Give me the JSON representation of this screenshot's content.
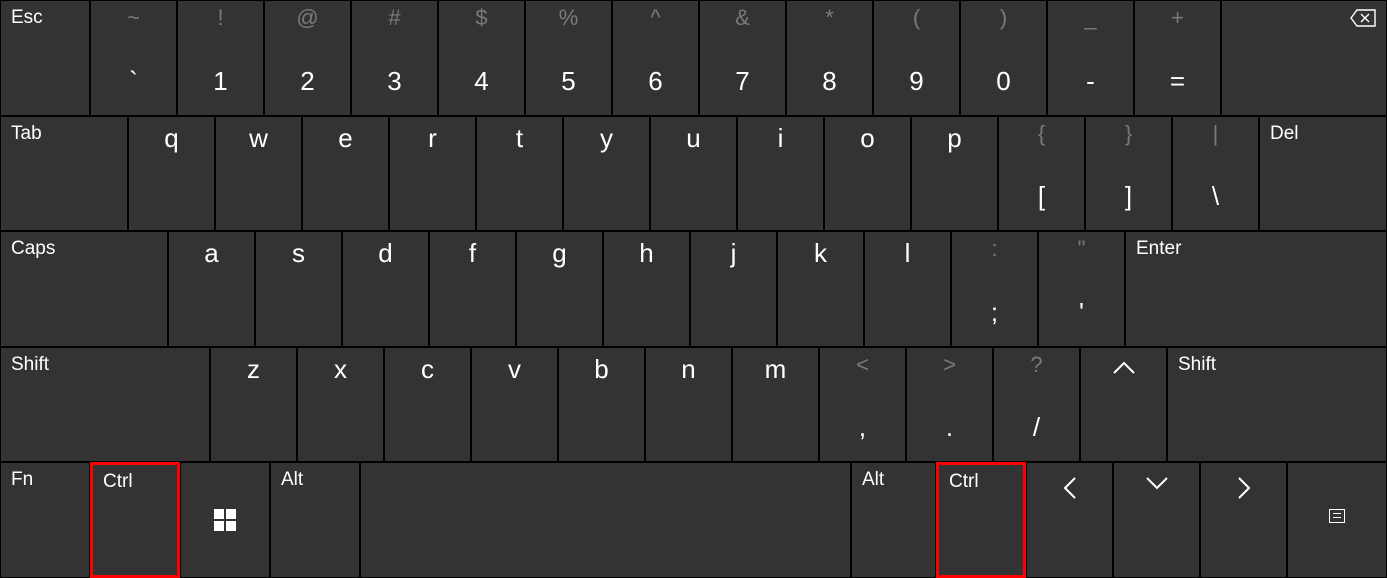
{
  "row1": {
    "esc": "Esc",
    "keys": [
      {
        "shift": "~",
        "main": "`"
      },
      {
        "shift": "!",
        "main": "1"
      },
      {
        "shift": "@",
        "main": "2"
      },
      {
        "shift": "#",
        "main": "3"
      },
      {
        "shift": "$",
        "main": "4"
      },
      {
        "shift": "%",
        "main": "5"
      },
      {
        "shift": "^",
        "main": "6"
      },
      {
        "shift": "&",
        "main": "7"
      },
      {
        "shift": "*",
        "main": "8"
      },
      {
        "shift": "(",
        "main": "9"
      },
      {
        "shift": ")",
        "main": "0"
      },
      {
        "shift": "_",
        "main": "-"
      },
      {
        "shift": "+",
        "main": "="
      }
    ],
    "backspace_icon": "⌫"
  },
  "row2": {
    "tab": "Tab",
    "letters": [
      "q",
      "w",
      "e",
      "r",
      "t",
      "y",
      "u",
      "i",
      "o",
      "p"
    ],
    "brackets": [
      {
        "shift": "{",
        "main": "["
      },
      {
        "shift": "}",
        "main": "]"
      },
      {
        "shift": "|",
        "main": "\\"
      }
    ],
    "del": "Del"
  },
  "row3": {
    "caps": "Caps",
    "letters": [
      "a",
      "s",
      "d",
      "f",
      "g",
      "h",
      "j",
      "k",
      "l"
    ],
    "punct": [
      {
        "shift": ":",
        "main": ";"
      },
      {
        "shift": "\"",
        "main": "'"
      }
    ],
    "enter": "Enter"
  },
  "row4": {
    "shiftL": "Shift",
    "letters": [
      "z",
      "x",
      "c",
      "v",
      "b",
      "n",
      "m"
    ],
    "punct": [
      {
        "shift": "<",
        "main": ","
      },
      {
        "shift": ">",
        "main": "."
      },
      {
        "shift": "?",
        "main": "/"
      }
    ],
    "shiftR": "Shift"
  },
  "row5": {
    "fn": "Fn",
    "ctrlL": "Ctrl",
    "altL": "Alt",
    "altR": "Alt",
    "ctrlR": "Ctrl"
  }
}
